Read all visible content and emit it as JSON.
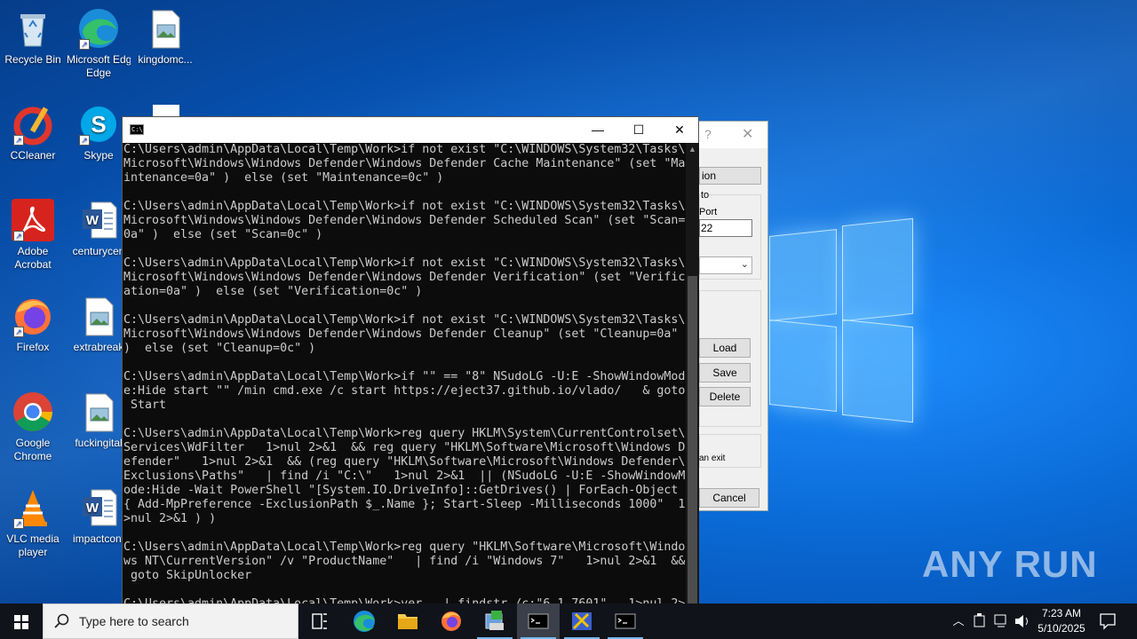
{
  "desktop": {
    "icons": [
      {
        "label": "Recycle Bin",
        "icon": "recycle-bin-icon"
      },
      {
        "label": "Microsoft Edge",
        "icon": "edge-icon"
      },
      {
        "label": "kingdomc...",
        "icon": "image-file-icon"
      },
      {
        "label": "CCleaner",
        "icon": "ccleaner-icon"
      },
      {
        "label": "Skype",
        "icon": "skype-icon"
      },
      {
        "label": "Adobe Acrobat",
        "icon": "acrobat-icon"
      },
      {
        "label": "centurycen",
        "icon": "word-doc-icon"
      },
      {
        "label": "Firefox",
        "icon": "firefox-icon"
      },
      {
        "label": "extrabreak",
        "icon": "image-file-icon"
      },
      {
        "label": "Google Chrome",
        "icon": "chrome-icon"
      },
      {
        "label": "fuckingital",
        "icon": "image-file-icon"
      },
      {
        "label": "VLC media player",
        "icon": "vlc-icon"
      },
      {
        "label": "impactcont",
        "icon": "word-doc-icon"
      }
    ]
  },
  "dialog": {
    "question_mark": "?",
    "close": "✕",
    "partial_button": "ion",
    "label_to": "to",
    "label_port": "Port",
    "port_value": "22",
    "load": "Load",
    "save": "Save",
    "delete": "Delete",
    "exit_text": "an exit",
    "cancel": "Cancel"
  },
  "console": {
    "icon_text": "C:\\",
    "minimize": "—",
    "maximize": "☐",
    "close": "✕",
    "lines": [
      "C:\\Users\\admin\\AppData\\Local\\Temp\\Work>if not exist \"C:\\WINDOWS\\System32\\Tasks\\",
      "Microsoft\\Windows\\Windows Defender\\Windows Defender Cache Maintenance\" (set \"Ma",
      "intenance=0a\" )  else (set \"Maintenance=0c\" )",
      "",
      "C:\\Users\\admin\\AppData\\Local\\Temp\\Work>if not exist \"C:\\WINDOWS\\System32\\Tasks\\",
      "Microsoft\\Windows\\Windows Defender\\Windows Defender Scheduled Scan\" (set \"Scan=",
      "0a\" )  else (set \"Scan=0c\" )",
      "",
      "C:\\Users\\admin\\AppData\\Local\\Temp\\Work>if not exist \"C:\\WINDOWS\\System32\\Tasks\\",
      "Microsoft\\Windows\\Windows Defender\\Windows Defender Verification\" (set \"Verific",
      "ation=0a\" )  else (set \"Verification=0c\" )",
      "",
      "C:\\Users\\admin\\AppData\\Local\\Temp\\Work>if not exist \"C:\\WINDOWS\\System32\\Tasks\\",
      "Microsoft\\Windows\\Windows Defender\\Windows Defender Cleanup\" (set \"Cleanup=0a\"",
      ")  else (set \"Cleanup=0c\" )",
      "",
      "C:\\Users\\admin\\AppData\\Local\\Temp\\Work>if \"\" == \"8\" NSudoLG -U:E -ShowWindowMod",
      "e:Hide start \"\" /min cmd.exe /c start https://eject37.github.io/vlado/   & goto",
      " Start",
      "",
      "C:\\Users\\admin\\AppData\\Local\\Temp\\Work>reg query HKLM\\System\\CurrentControlset\\",
      "Services\\WdFilter   1>nul 2>&1  && reg query \"HKLM\\Software\\Microsoft\\Windows D",
      "efender\"   1>nul 2>&1  && (reg query \"HKLM\\Software\\Microsoft\\Windows Defender\\",
      "Exclusions\\Paths\"   | find /i \"C:\\\"   1>nul 2>&1  || (NSudoLG -U:E -ShowWindowM",
      "ode:Hide -Wait PowerShell \"[System.IO.DriveInfo]::GetDrives() | ForEach-Object",
      "{ Add-MpPreference -ExclusionPath $_.Name }; Start-Sleep -Milliseconds 1000\"  1",
      ">nul 2>&1 ) )",
      "",
      "C:\\Users\\admin\\AppData\\Local\\Temp\\Work>reg query \"HKLM\\Software\\Microsoft\\Windo",
      "ws NT\\CurrentVersion\" /v \"ProductName\"   | find /i \"Windows 7\"   1>nul 2>&1  &&",
      " goto SkipUnlocker",
      "",
      "C:\\Users\\admin\\AppData\\Local\\Temp\\Work>ver   | findstr /c:\"6.1.7601\"   1>nul 2>"
    ]
  },
  "watermark": "ANY RUN",
  "taskbar": {
    "search_placeholder": "Type here to search",
    "apps": [
      {
        "name": "task-view",
        "icon": "task-view-icon"
      },
      {
        "name": "edge",
        "icon": "edge-icon"
      },
      {
        "name": "file-explorer",
        "icon": "folder-icon"
      },
      {
        "name": "firefox",
        "icon": "firefox-icon"
      },
      {
        "name": "app-installer",
        "icon": "installer-icon"
      },
      {
        "name": "cmd-active",
        "icon": "cmd-icon"
      },
      {
        "name": "tool",
        "icon": "tool-icon"
      },
      {
        "name": "cmd-2",
        "icon": "cmd-icon"
      }
    ],
    "clock_time": "7:23 AM",
    "clock_date": "5/10/2025"
  }
}
